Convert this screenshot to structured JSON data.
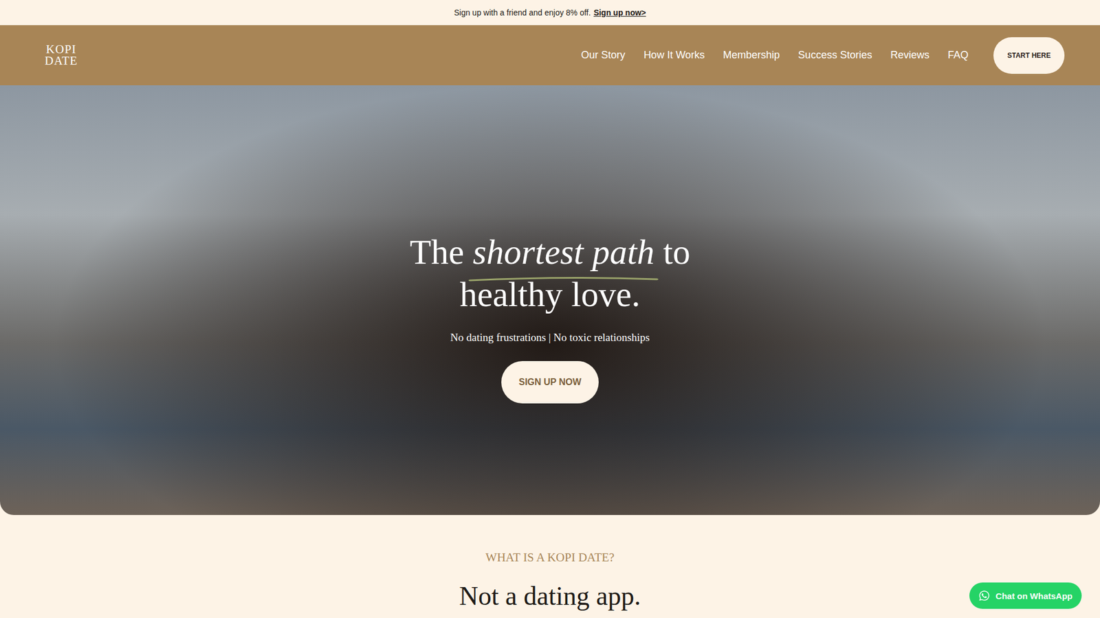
{
  "announcement": {
    "text": "Sign up with a friend and enjoy 8% off.",
    "link": "Sign up now>"
  },
  "nav": {
    "logo": [
      "KOPI",
      "DATE"
    ],
    "links": [
      "Our Story",
      "How It Works",
      "Membership",
      "Success Stories",
      "Reviews",
      "FAQ"
    ],
    "cta": "START HERE"
  },
  "hero": {
    "title_start": "The",
    "title_emphasis": "shortest path",
    "title_mid": "to",
    "title_end": "healthy love.",
    "subtitle": "No dating frustrations | No toxic relationships",
    "button": "SIGN UP NOW"
  },
  "intro": {
    "eyebrow": "WHAT IS A KOPI DATE?",
    "heading": "Not a dating app."
  },
  "chat": {
    "label": "Chat on WhatsApp"
  }
}
